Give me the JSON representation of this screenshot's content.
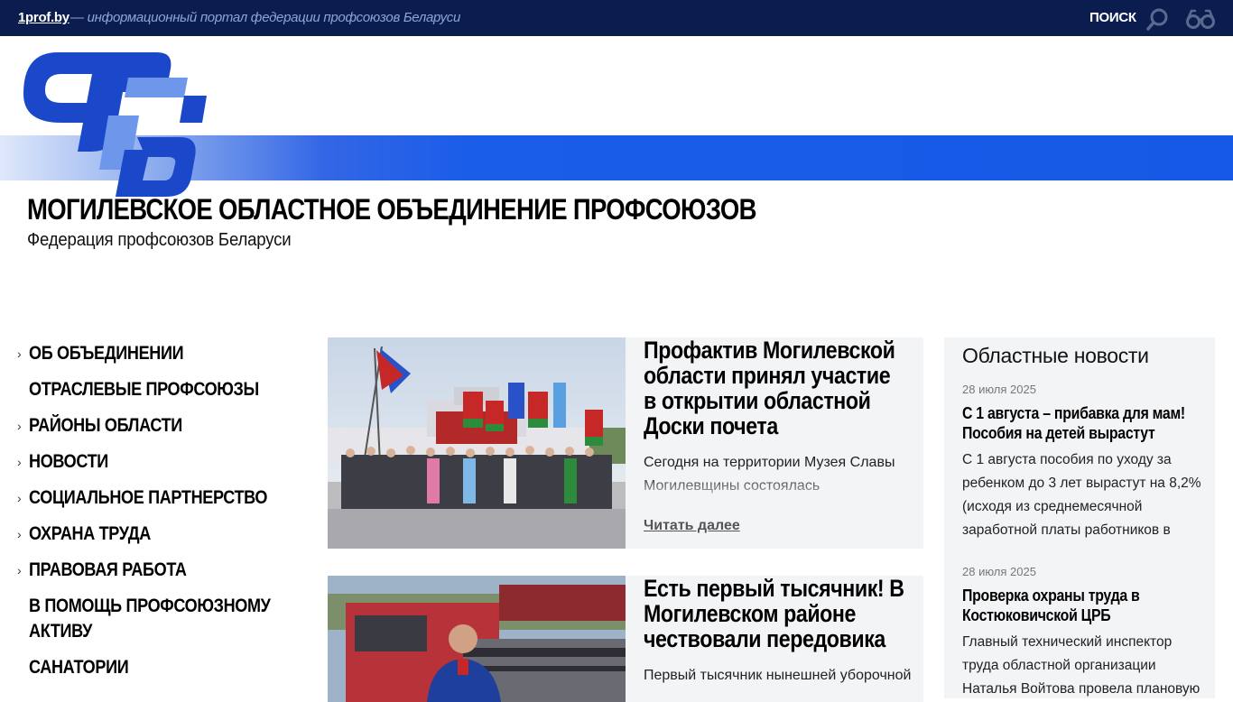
{
  "topbar": {
    "site": "1prof.by",
    "tagline": "— информационный портал федерации профсоюзов Беларуси",
    "search_label": "ПОИСК"
  },
  "header": {
    "title": "МОГИЛЕВСКОЕ ОБЛАСТНОЕ ОБЪЕДИНЕНИЕ ПРОФСОЮЗОВ",
    "subtitle": "Федерация профсоюзов Беларуси"
  },
  "colors": {
    "topbar": "#0b1d4e",
    "brand_blue": "#1559e6",
    "logo_dark": "#1a48c8",
    "logo_light": "#6e97ec"
  },
  "menu": [
    {
      "label": "ОБ ОБЪЕДИНЕНИИ",
      "has_arrow": true
    },
    {
      "label": "ОТРАСЛЕВЫЕ ПРОФСОЮЗЫ",
      "has_arrow": false
    },
    {
      "label": "РАЙОНЫ ОБЛАСТИ",
      "has_arrow": true
    },
    {
      "label": "НОВОСТИ",
      "has_arrow": true
    },
    {
      "label": "СОЦИАЛЬНОЕ ПАРТНЕРСТВО",
      "has_arrow": true
    },
    {
      "label": "ОХРАНА ТРУДА",
      "has_arrow": true
    },
    {
      "label": "ПРАВОВАЯ РАБОТА",
      "has_arrow": true
    },
    {
      "label": "В ПОМОЩЬ ПРОФСОЮЗНОМУ АКТИВУ",
      "has_arrow": false
    },
    {
      "label": "САНАТОРИИ",
      "has_arrow": false
    }
  ],
  "news": [
    {
      "title": "Профактив Могилевской области принял участие в открытии областной Доски почета",
      "excerpt": "Сегодня на территории Музея Славы Могилевщины состоялась",
      "read_more": "Читать далее"
    },
    {
      "title": "Есть первый тысячник! В Могилевском районе чествовали передовика",
      "excerpt": "Первый тысячник нынешней уборочной"
    }
  ],
  "regional": {
    "title": "Областные новости",
    "items": [
      {
        "date": "28 июля 2025",
        "title": "С 1 августа – прибавка для мам! Пособия на детей вырастут",
        "text": "С 1 августа пособия по уходу за ребенком до 3 лет вырастут на 8,2% (исходя из среднемесячной заработной платы работников в"
      },
      {
        "date": "28 июля 2025",
        "title": "Проверка охраны труда в Костюковичской ЦРБ",
        "text": "Главный технический инспектор труда областной организации Наталья Войтова провела плановую"
      }
    ]
  }
}
